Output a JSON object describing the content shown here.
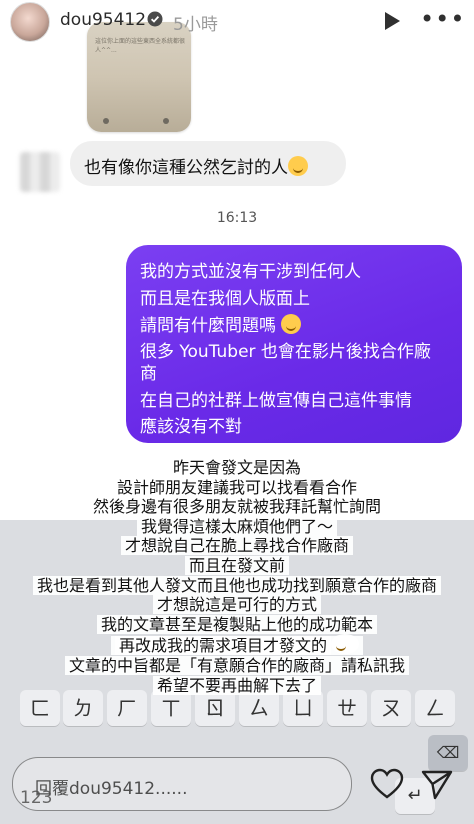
{
  "header": {
    "username": "dou95412",
    "time_ago": "5小時"
  },
  "chat": {
    "screenshot_caption": "這位你上面的這些東西全系統都很人^^...",
    "incoming_message": "也有像你這種公然乞討的人",
    "timestamp": "16:13",
    "outgoing_lines": [
      "我的方式並沒有干涉到任何人",
      "而且是在我個人版面上",
      "請問有什麼問題嗎",
      "很多 YouTuber 也會在影片後找合作廠",
      "商",
      "在自己的社群上做宣傳自己這件事情",
      "應該沒有不對"
    ]
  },
  "caption": {
    "lines": [
      "昨天會發文是因為",
      "設計師朋友建議我可以找看看合作",
      "然後身邊有很多朋友就被我拜託幫忙詢問",
      "我覺得這樣太麻煩他們了～",
      "才想說自己在脆上尋找合作廠商",
      "而且在發文前",
      "我也是看到其他人發文而且他也成功找到願意合作的廠商",
      "才想說這是可行的方式",
      "我的文章甚至是複製貼上他的成功範本",
      "再改成我的需求項目才發文的",
      "文章的中旨都是「有意願合作的廠商」請私訊我",
      "希望不要再曲解下去了"
    ]
  },
  "keyboard": {
    "row1": [
      "ㄈ",
      "ㄉ",
      "ㄏ",
      "ㄒ",
      "ㄖ",
      "ㄙ",
      "ㄩ",
      "ㄝ",
      "ㄡ",
      "ㄥ"
    ],
    "mode_key": "123"
  },
  "reply": {
    "placeholder": "回覆dou95412......"
  },
  "icons": {
    "verified": "verified-badge-icon",
    "play": "play-icon",
    "more": "more-options-icon",
    "heart": "heart-icon",
    "send": "send-icon"
  }
}
